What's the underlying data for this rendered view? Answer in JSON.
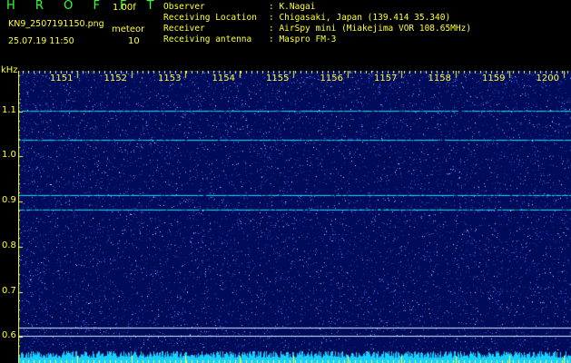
{
  "header": {
    "brand": "H R O F F T",
    "version": "1.00f",
    "filename": "KN9_2507191150.png",
    "meteor_label": "meteor",
    "timestamp": "25.07.19 11:50",
    "count": "10"
  },
  "info": [
    {
      "key": "Observer",
      "value": ": K.Nagai"
    },
    {
      "key": "Receiving Location",
      "value": ": Chigasaki, Japan (139.414 35.340)"
    },
    {
      "key": "Receiver",
      "value": ": AirSpy mini (Miakejima VOR 108.65MHz)"
    },
    {
      "key": "Receiving antenna",
      "value": ": Maspro FM-3"
    }
  ],
  "spectrogram": {
    "y_unit": "kHz",
    "y_ticks": [
      "1.1",
      "1.0",
      "0.9",
      "0.8",
      "0.7",
      "0.6"
    ],
    "x_ticks": [
      "1151",
      "1152",
      "1153",
      "1154",
      "1155",
      "1156",
      "1157",
      "1158",
      "1159",
      "1200"
    ],
    "background": "#000c5a",
    "axis_color": "#ffff33",
    "trace_color": "#00e0ff",
    "lines_khz": [
      1.102,
      1.037,
      0.915,
      0.882
    ],
    "reference_lines_khz": [
      0.621,
      0.603
    ]
  }
}
